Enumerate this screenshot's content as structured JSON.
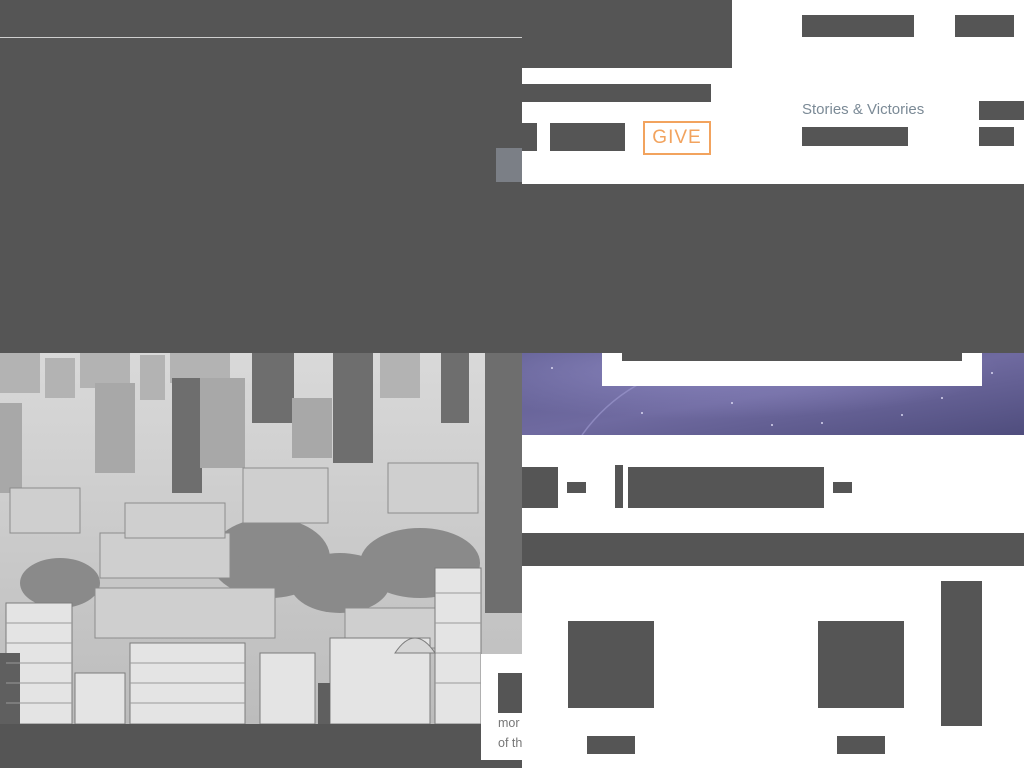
{
  "header": {
    "give_label": "GIVE",
    "nav": [
      {
        "label": "Stories & Victories"
      }
    ]
  },
  "caption": {
    "line1": "mor",
    "line2": "of th"
  },
  "colors": {
    "accent": "#f2a35e",
    "nav_text": "#7b8a96",
    "redacted_block": "#555555",
    "caption_text": "#777777"
  }
}
